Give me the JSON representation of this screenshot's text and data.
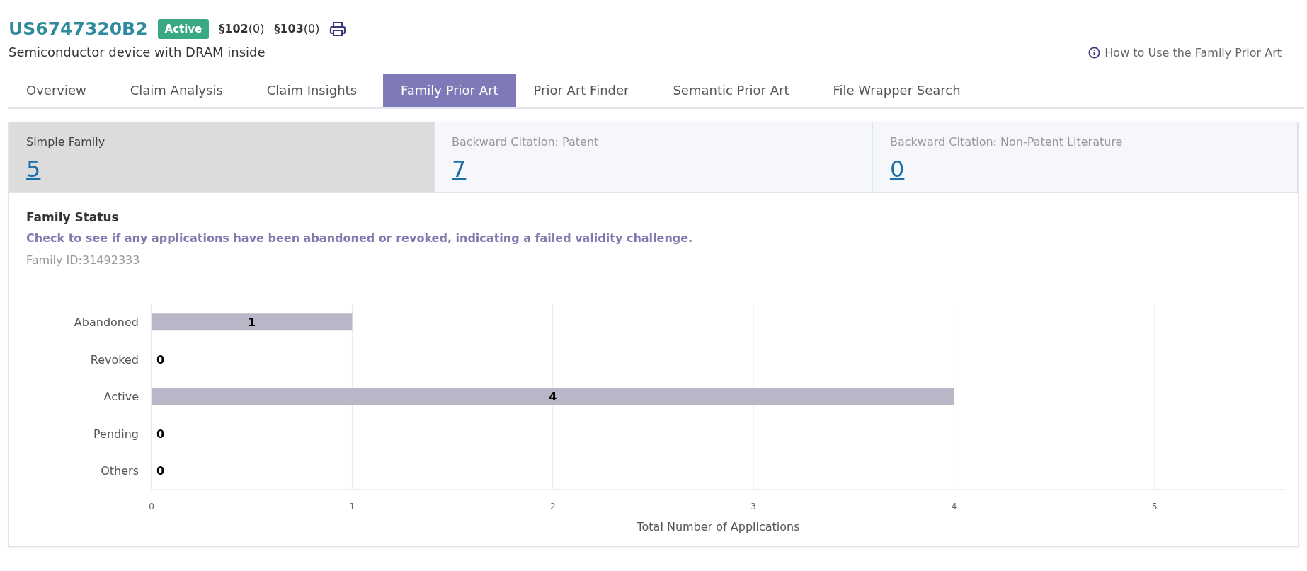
{
  "patent": {
    "number": "US6747320B2",
    "status": "Active",
    "sections": [
      {
        "code": "§102",
        "count": "(0)"
      },
      {
        "code": "§103",
        "count": "(0)"
      }
    ],
    "title": "Semiconductor device with DRAM inside"
  },
  "help_link": "How to Use the Family Prior Art",
  "tabs": [
    {
      "label": "Overview",
      "selected": false
    },
    {
      "label": "Claim Analysis",
      "selected": false
    },
    {
      "label": "Claim Insights",
      "selected": false
    },
    {
      "label": "Family Prior Art",
      "selected": true
    },
    {
      "label": "Prior Art Finder",
      "selected": false
    },
    {
      "label": "Semantic Prior Art",
      "selected": false
    },
    {
      "label": "File Wrapper Search",
      "selected": false
    }
  ],
  "stats": [
    {
      "label": "Simple Family",
      "value": "5",
      "selected": true
    },
    {
      "label": "Backward Citation: Patent",
      "value": "7",
      "selected": false
    },
    {
      "label": "Backward Citation: Non-Patent Literature",
      "value": "0",
      "selected": false
    }
  ],
  "family_status": {
    "heading": "Family Status",
    "description": "Check to see if any applications have been abandoned or revoked, indicating a failed validity challenge.",
    "family_id": "Family ID:31492333",
    "chart_data": {
      "type": "bar",
      "orientation": "horizontal",
      "xlabel": "Total Number of Applications",
      "categories": [
        "Abandoned",
        "Revoked",
        "Active",
        "Pending",
        "Others"
      ],
      "series": [
        {
          "color": "#bab6c8",
          "values": [
            1,
            0,
            4,
            0,
            0
          ]
        }
      ],
      "xlim": [
        0,
        5.65
      ],
      "xticks": [
        0,
        1,
        2,
        3,
        4,
        5
      ],
      "grid": true,
      "data_labels": true
    }
  }
}
